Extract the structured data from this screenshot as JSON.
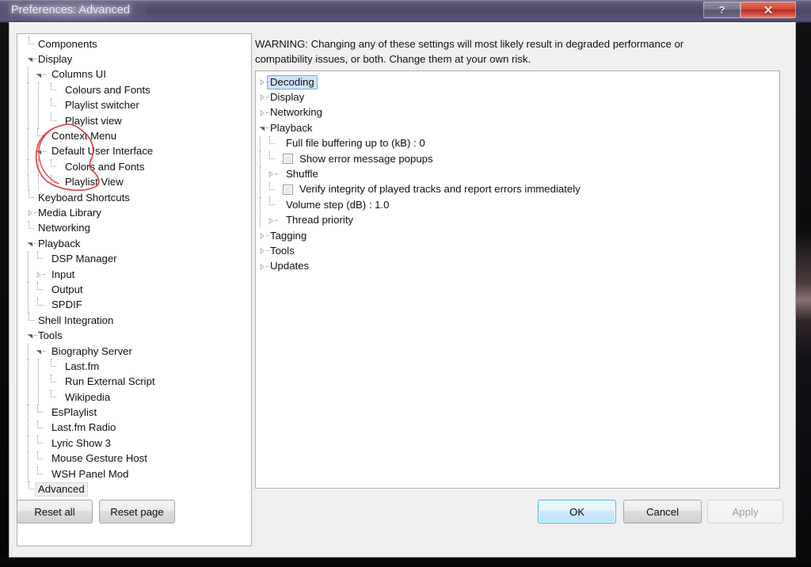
{
  "window": {
    "title": "Preferences: Advanced",
    "caption_buttons": [
      {
        "name": "help-button",
        "glyph": "?"
      },
      {
        "name": "close-button",
        "glyph": "✕"
      }
    ]
  },
  "sidebar": {
    "items": [
      {
        "label": "Components",
        "depth": 0,
        "expander": "none",
        "selected": false
      },
      {
        "label": "Display",
        "depth": 0,
        "expander": "expanded",
        "selected": false
      },
      {
        "label": "Columns UI",
        "depth": 1,
        "expander": "expanded",
        "selected": false
      },
      {
        "label": "Colours and Fonts",
        "depth": 2,
        "expander": "none",
        "selected": false
      },
      {
        "label": "Playlist switcher",
        "depth": 2,
        "expander": "none",
        "selected": false
      },
      {
        "label": "Playlist view",
        "depth": 2,
        "expander": "none",
        "selected": false
      },
      {
        "label": "Context Menu",
        "depth": 1,
        "expander": "none",
        "selected": false
      },
      {
        "label": "Default User Interface",
        "depth": 1,
        "expander": "expanded",
        "selected": false
      },
      {
        "label": "Colors and Fonts",
        "depth": 2,
        "expander": "none",
        "selected": false
      },
      {
        "label": "Playlist View",
        "depth": 2,
        "expander": "none",
        "selected": false
      },
      {
        "label": "Keyboard Shortcuts",
        "depth": 0,
        "expander": "none",
        "selected": false
      },
      {
        "label": "Media Library",
        "depth": 0,
        "expander": "collapsed",
        "selected": false
      },
      {
        "label": "Networking",
        "depth": 0,
        "expander": "none",
        "selected": false
      },
      {
        "label": "Playback",
        "depth": 0,
        "expander": "expanded",
        "selected": false
      },
      {
        "label": "DSP Manager",
        "depth": 1,
        "expander": "none",
        "selected": false
      },
      {
        "label": "Input",
        "depth": 1,
        "expander": "collapsed",
        "selected": false
      },
      {
        "label": "Output",
        "depth": 1,
        "expander": "none",
        "selected": false
      },
      {
        "label": "SPDIF",
        "depth": 1,
        "expander": "none",
        "selected": false
      },
      {
        "label": "Shell Integration",
        "depth": 0,
        "expander": "none",
        "selected": false
      },
      {
        "label": "Tools",
        "depth": 0,
        "expander": "expanded",
        "selected": false
      },
      {
        "label": "Biography Server",
        "depth": 1,
        "expander": "expanded",
        "selected": false
      },
      {
        "label": "Last.fm",
        "depth": 2,
        "expander": "none",
        "selected": false
      },
      {
        "label": "Run External Script",
        "depth": 2,
        "expander": "none",
        "selected": false
      },
      {
        "label": "Wikipedia",
        "depth": 2,
        "expander": "none",
        "selected": false
      },
      {
        "label": "EsPlaylist",
        "depth": 1,
        "expander": "none",
        "selected": false
      },
      {
        "label": "Last.fm Radio",
        "depth": 1,
        "expander": "none",
        "selected": false
      },
      {
        "label": "Lyric Show 3",
        "depth": 1,
        "expander": "none",
        "selected": false
      },
      {
        "label": "Mouse Gesture Host",
        "depth": 1,
        "expander": "none",
        "selected": false
      },
      {
        "label": "WSH Panel Mod",
        "depth": 1,
        "expander": "none",
        "selected": false
      },
      {
        "label": "Advanced",
        "depth": 0,
        "expander": "none",
        "selected": "gray"
      }
    ]
  },
  "main": {
    "warning": "WARNING: Changing any of these settings will most likely result in degraded performance or compatibility issues, or both. Change them at your own risk.",
    "settings_tree": [
      {
        "label": "Decoding",
        "depth": 0,
        "expander": "collapsed",
        "checkbox": false,
        "selected": "blue"
      },
      {
        "label": "Display",
        "depth": 0,
        "expander": "collapsed",
        "checkbox": false,
        "selected": false
      },
      {
        "label": "Networking",
        "depth": 0,
        "expander": "collapsed",
        "checkbox": false,
        "selected": false
      },
      {
        "label": "Playback",
        "depth": 0,
        "expander": "expanded",
        "checkbox": false,
        "selected": false
      },
      {
        "label": "Full file buffering up to (kB) : 0",
        "depth": 1,
        "expander": "none",
        "checkbox": false,
        "selected": false
      },
      {
        "label": "Show error message popups",
        "depth": 1,
        "expander": "none",
        "checkbox": true,
        "selected": false
      },
      {
        "label": "Shuffle",
        "depth": 1,
        "expander": "collapsed",
        "checkbox": false,
        "selected": false
      },
      {
        "label": "Verify integrity of played tracks and report errors immediately",
        "depth": 1,
        "expander": "none",
        "checkbox": true,
        "selected": false
      },
      {
        "label": "Volume step (dB) : 1.0",
        "depth": 1,
        "expander": "none",
        "checkbox": false,
        "selected": false
      },
      {
        "label": "Thread priority",
        "depth": 1,
        "expander": "collapsed",
        "checkbox": false,
        "selected": false
      },
      {
        "label": "Tagging",
        "depth": 0,
        "expander": "collapsed",
        "checkbox": false,
        "selected": false
      },
      {
        "label": "Tools",
        "depth": 0,
        "expander": "collapsed",
        "checkbox": false,
        "selected": false
      },
      {
        "label": "Updates",
        "depth": 0,
        "expander": "collapsed",
        "checkbox": false,
        "selected": false
      }
    ]
  },
  "footer": {
    "reset_all": "Reset all",
    "reset_page": "Reset page",
    "ok": "OK",
    "cancel": "Cancel",
    "apply": "Apply"
  },
  "annotation": {
    "shape": "red-ellipse-highlight",
    "color": "#e04a52",
    "targets": "Show error message popups checkbox"
  }
}
